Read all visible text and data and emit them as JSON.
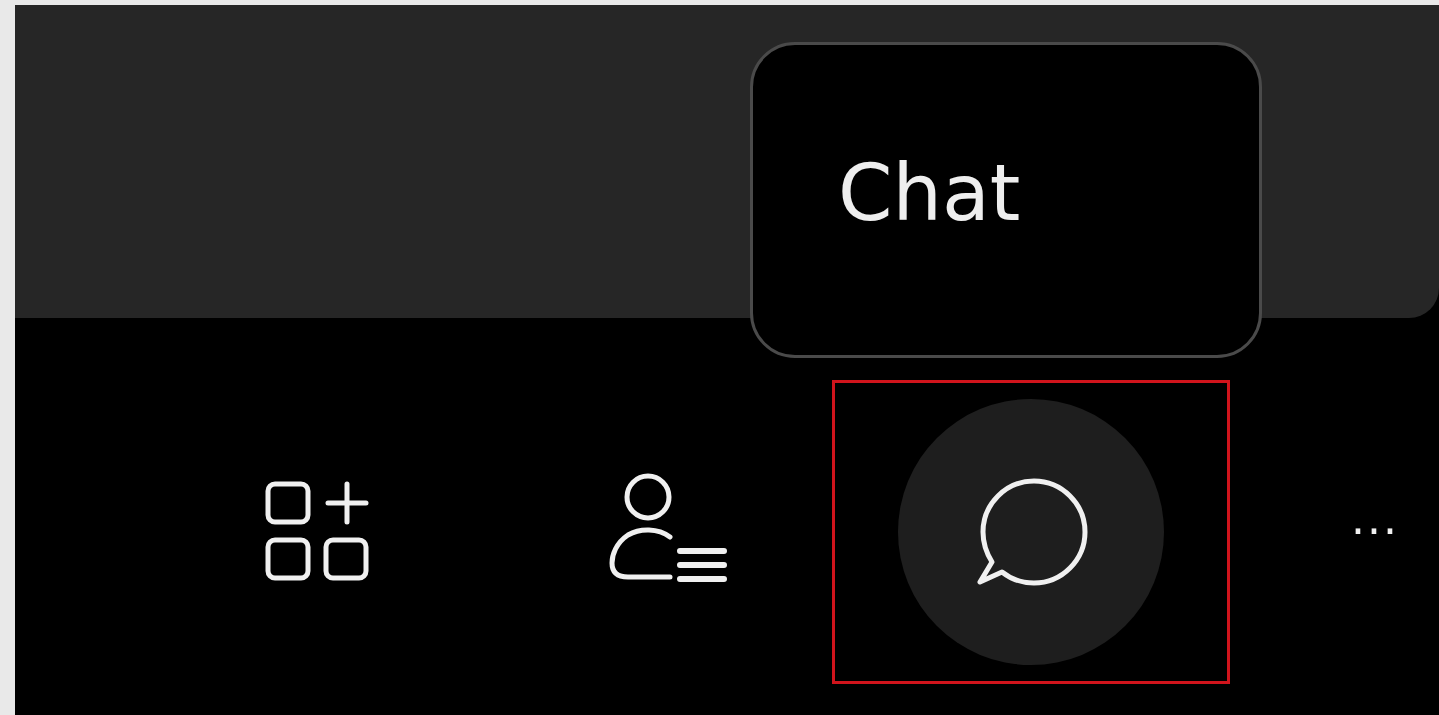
{
  "tooltip": {
    "text": "Chat"
  },
  "toolbar": [
    {
      "kind": "apps",
      "selected": false,
      "highlighted": false
    },
    {
      "kind": "people",
      "selected": false,
      "highlighted": false
    },
    {
      "kind": "chat",
      "selected": true,
      "highlighted": true
    },
    {
      "kind": "more",
      "label": "···",
      "selected": false,
      "highlighted": false
    }
  ]
}
